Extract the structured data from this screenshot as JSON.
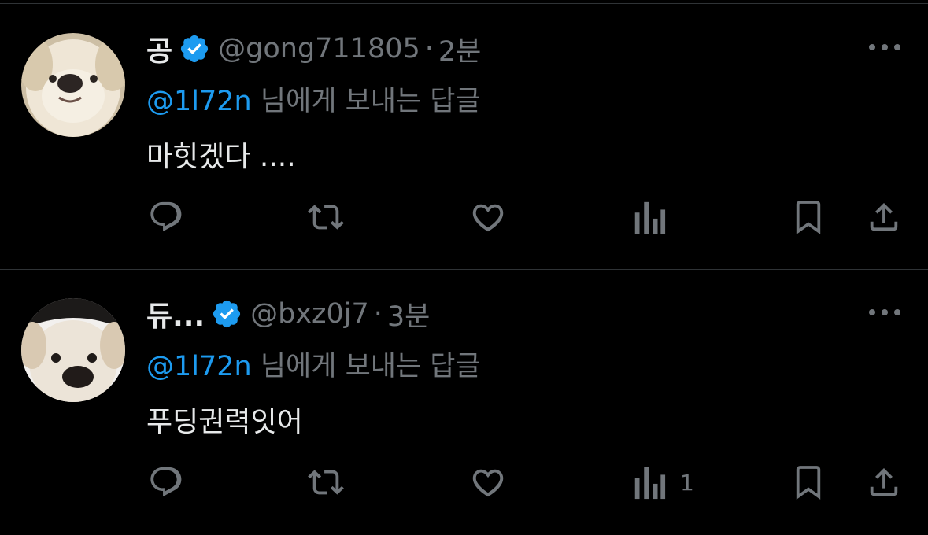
{
  "tweets": [
    {
      "name": "공",
      "handle": "@gong711805",
      "dot": "·",
      "time": "2분",
      "reply_mention": "@1l72n",
      "reply_suffix": " 님에게 보내는 답글",
      "text": "마힛겠다 ....",
      "views_count": ""
    },
    {
      "name": "듀...",
      "handle": "@bxz0j7",
      "dot": "·",
      "time": "3분",
      "reply_mention": "@1l72n",
      "reply_suffix": " 님에게 보내는 답글",
      "text": "푸딩권력잇어",
      "views_count": "1"
    }
  ],
  "icons": [
    "verified-badge-icon",
    "more-icon",
    "reply-icon",
    "retweet-icon",
    "like-icon",
    "views-icon",
    "bookmark-icon",
    "share-icon"
  ],
  "colors": {
    "background": "#000000",
    "text": "#e7e9ea",
    "muted": "#71767b",
    "accent": "#1d9bf0",
    "divider": "#2f3336"
  }
}
